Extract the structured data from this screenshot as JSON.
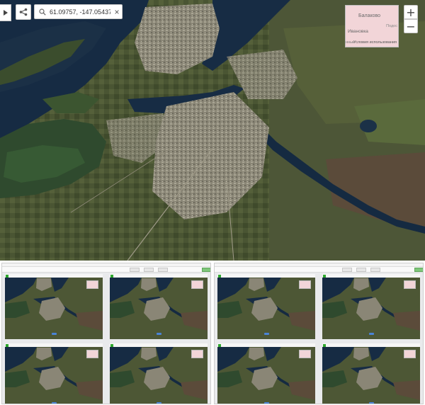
{
  "search": {
    "value": "61.09757, -147.05437",
    "placeholder": "",
    "clear_label": "×"
  },
  "zoom": {
    "in_label": "+",
    "out_label": "−"
  },
  "minimap": {
    "label_city": "Балаково",
    "label_region": "Подос",
    "label_village": "Ивановка",
    "label_left": "нные",
    "terms_label": "Условия использования"
  },
  "icons": [
    "chevron-right-icon",
    "share-icon",
    "search-icon",
    "close-icon",
    "plus-icon",
    "minus-icon"
  ],
  "colors": {
    "water": "#152a41",
    "land_dark": "#384a2a",
    "field_brown": "#5b4b3a",
    "urban": "#8d8a7a",
    "label_green": "#2e9a2e",
    "minimap_pink": "#f2d5d8"
  },
  "thumbnails": {
    "count_screens": 2,
    "cells_per_screen": 4
  }
}
